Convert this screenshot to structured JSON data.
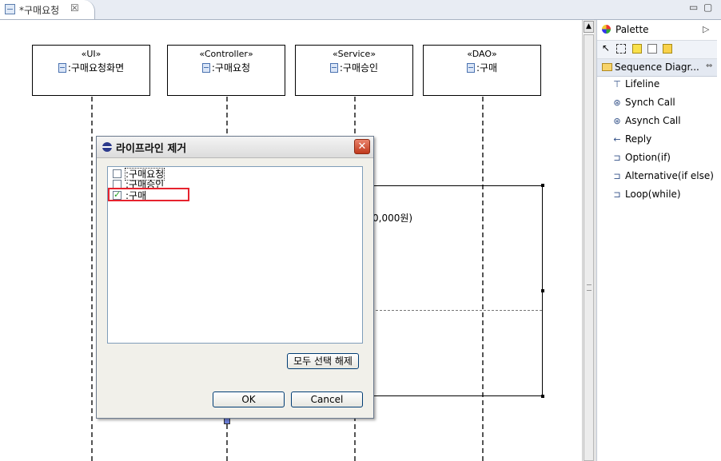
{
  "editor_tab": {
    "title": "*구매요청",
    "close_glyph": "☒"
  },
  "window_controls": {
    "minimize": "▭",
    "maximize": "▢"
  },
  "lifelines": [
    {
      "stereotype": "«UI»",
      "name": ":구매요청화면"
    },
    {
      "stereotype": "«Controller»",
      "name": ":구매요청"
    },
    {
      "stereotype": "«Service»",
      "name": ":구매승인"
    },
    {
      "stereotype": "«DAO»",
      "name": ":구매"
    }
  ],
  "diagram_fragment_text": "0,000원)",
  "palette": {
    "title": "Palette",
    "drawer_label": "Sequence Diagr...",
    "items": [
      {
        "label": "Lifeline",
        "icon": "lifeline-icon",
        "glyph": "⊤"
      },
      {
        "label": "Synch Call",
        "icon": "synch-call-icon",
        "glyph": "⊛"
      },
      {
        "label": "Asynch Call",
        "icon": "asynch-call-icon",
        "glyph": "⊛"
      },
      {
        "label": "Reply",
        "icon": "reply-icon",
        "glyph": "←"
      },
      {
        "label": "Option(if)",
        "icon": "option-icon",
        "glyph": "⊐"
      },
      {
        "label": "Alternative(if else)",
        "icon": "alternative-icon",
        "glyph": "⊐"
      },
      {
        "label": "Loop(while)",
        "icon": "loop-icon",
        "glyph": "⊐"
      }
    ]
  },
  "dialog": {
    "title": "라이프라인 제거",
    "close_glyph": "✕",
    "items": [
      {
        "label": ":구매요청",
        "checked": false,
        "focused": true
      },
      {
        "label": ":구매승인",
        "checked": false,
        "focused": false
      },
      {
        "label": ":구매",
        "checked": true,
        "focused": false
      }
    ],
    "deselect_all_label": "모두 선택 해제",
    "ok_label": "OK",
    "cancel_label": "Cancel"
  },
  "colors": {
    "highlight_box": "#e6232e",
    "activation": "#6d7ed8",
    "checkmark": "#21a121"
  }
}
